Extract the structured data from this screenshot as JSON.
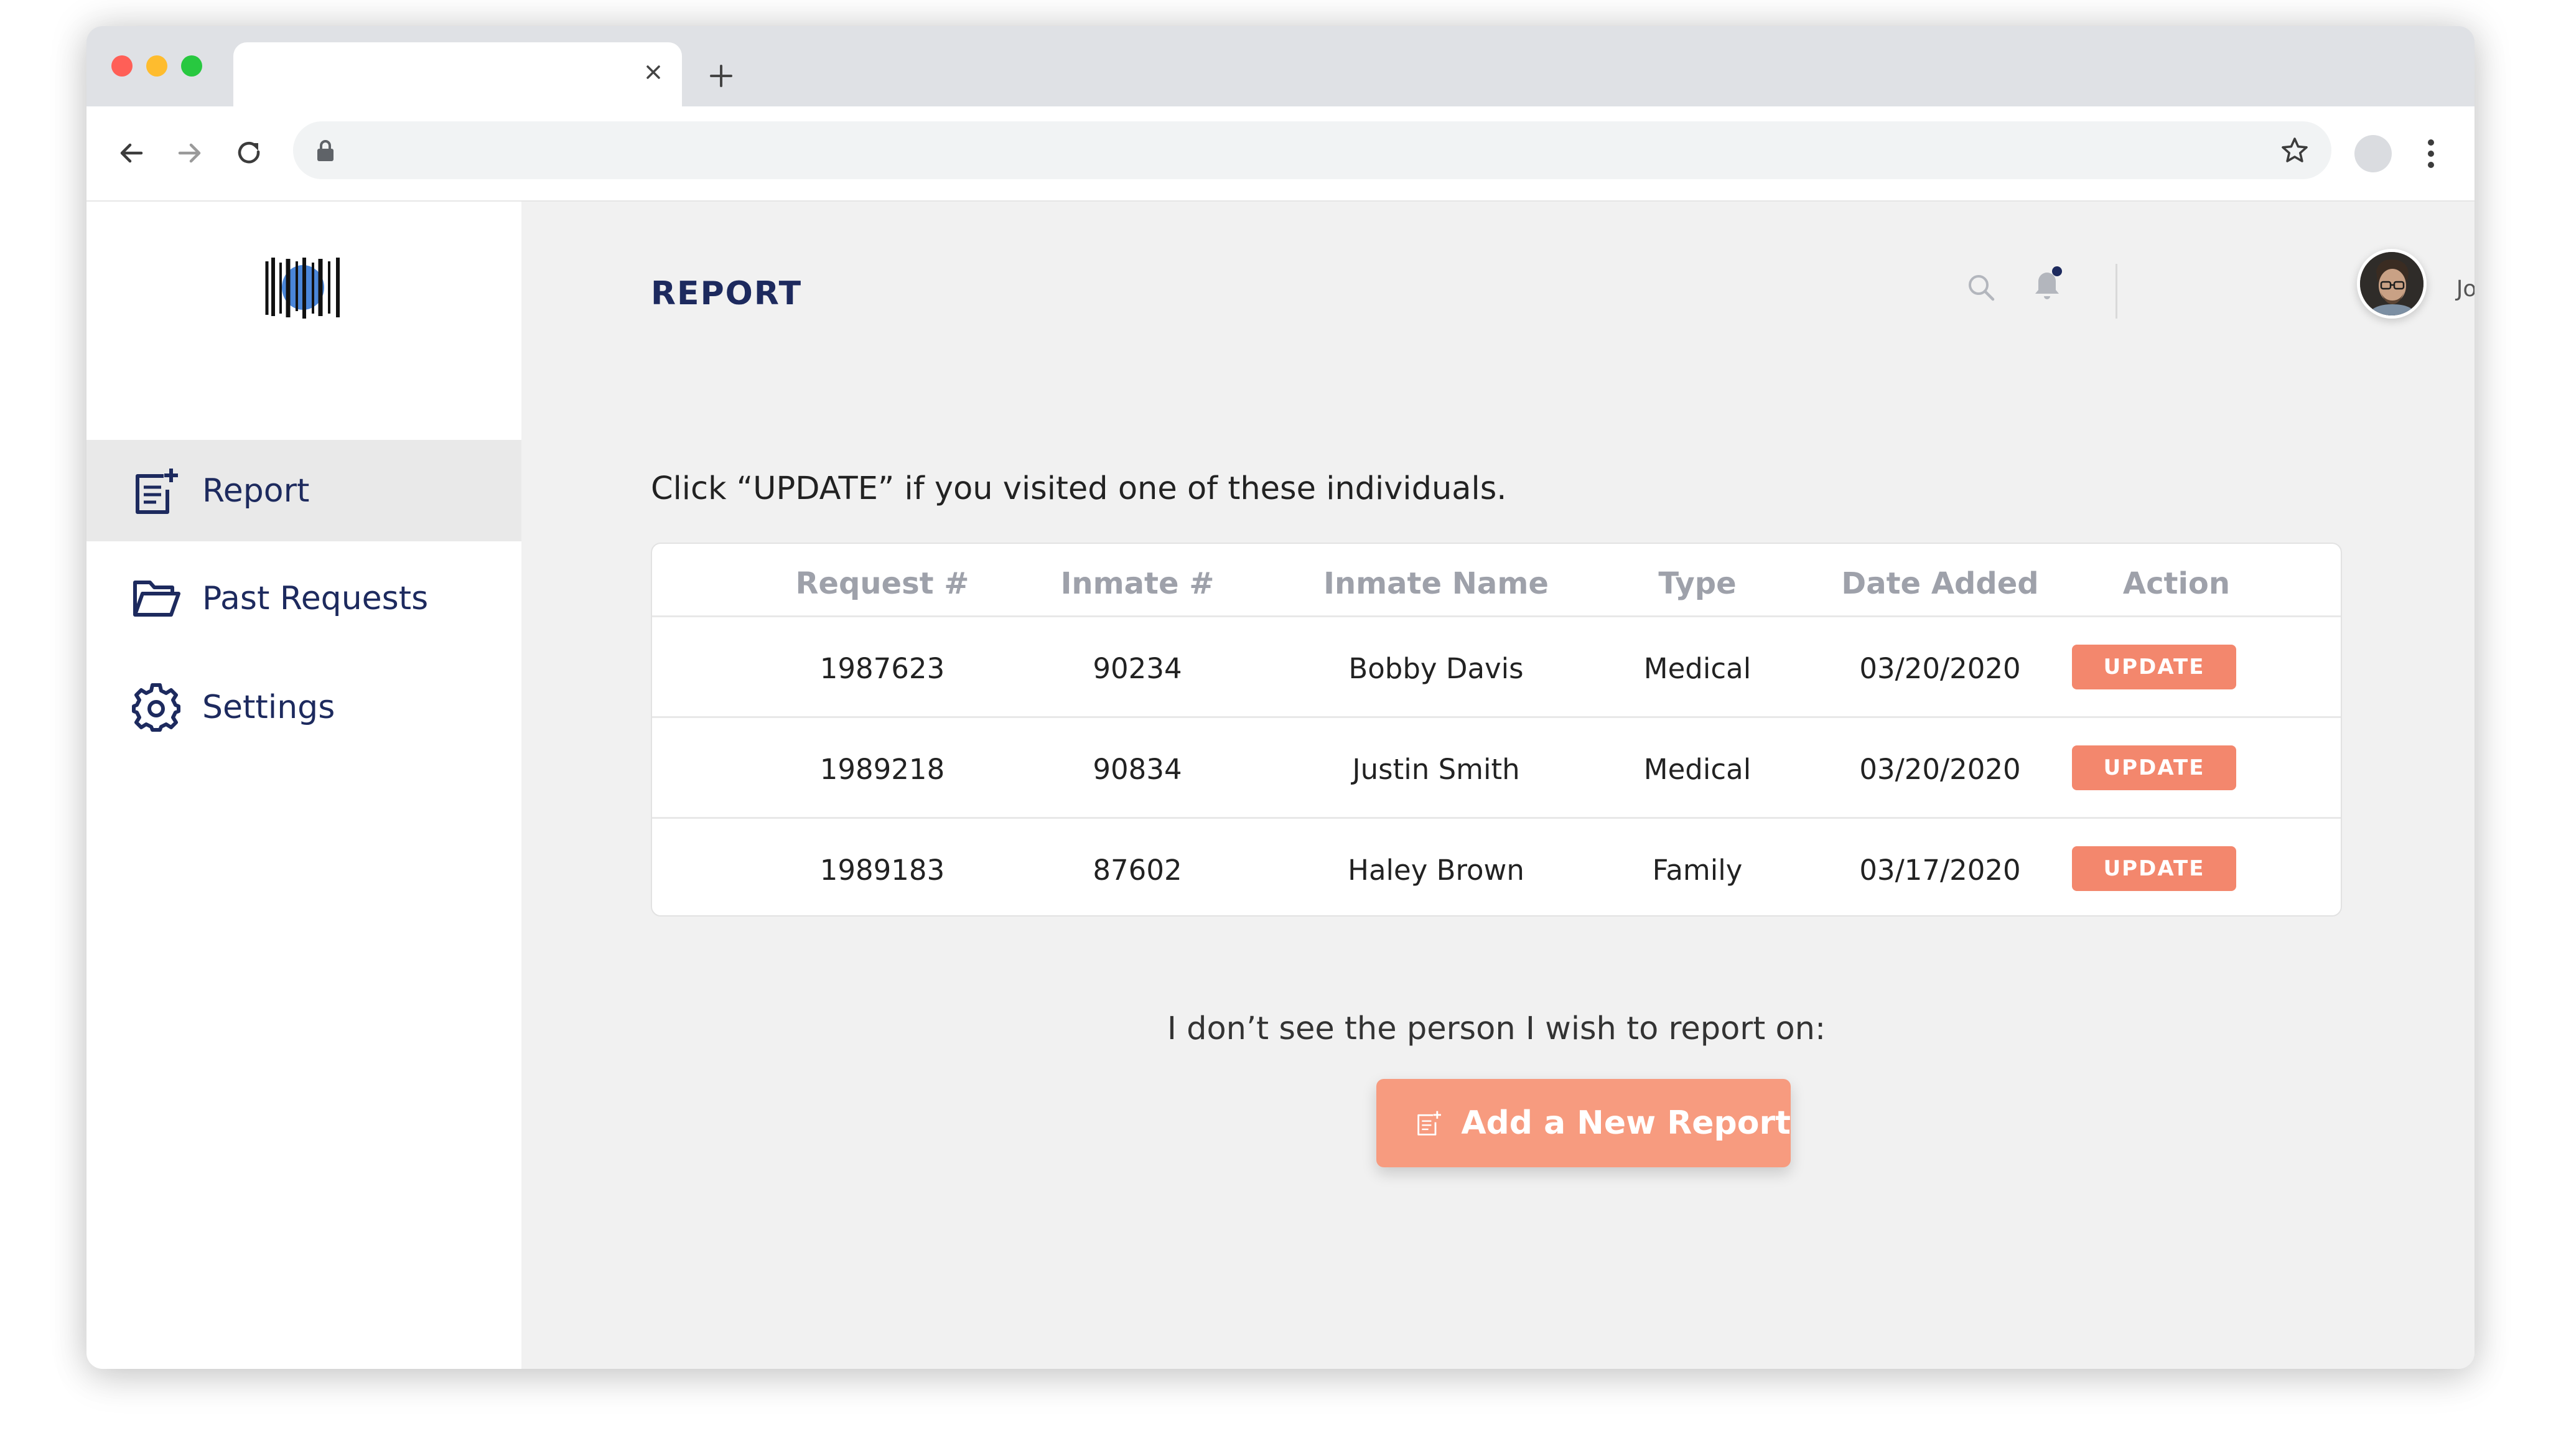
{
  "browser": {
    "tab_title": "",
    "tab_close_icon": "close-icon",
    "new_tab_icon": "plus-icon",
    "url": "",
    "nav_icons": [
      "arrow-left-icon",
      "arrow-right-icon",
      "reload-icon"
    ]
  },
  "sidebar": {
    "logo_icon": "barcode-logo",
    "items": [
      {
        "label": "Report",
        "icon": "report-add-icon",
        "active": true
      },
      {
        "label": "Past Requests",
        "icon": "folder-open-icon",
        "active": false
      },
      {
        "label": "Settings",
        "icon": "gear-icon",
        "active": false
      }
    ]
  },
  "header": {
    "title": "REPORT",
    "user_name": "Jones Ferdinand"
  },
  "main": {
    "instruction": "Click “UPDATE” if you visited one of these individuals.",
    "table": {
      "columns": [
        "Request #",
        "Inmate #",
        "Inmate Name",
        "Type",
        "Date Added",
        "Action"
      ],
      "rows": [
        {
          "request": "1987623",
          "inmate": "90234",
          "name": "Bobby Davis",
          "type": "Medical",
          "date": "03/20/2020",
          "action": "UPDATE"
        },
        {
          "request": "1989218",
          "inmate": "90834",
          "name": "Justin Smith",
          "type": "Medical",
          "date": "03/20/2020",
          "action": "UPDATE"
        },
        {
          "request": "1989183",
          "inmate": "87602",
          "name": "Haley Brown",
          "type": "Family",
          "date": "03/17/2020",
          "action": "UPDATE"
        }
      ]
    },
    "no_person_text": "I don’t see the person I wish to report on:",
    "add_report_label": "Add a New Report"
  },
  "colors": {
    "navy": "#1d2a5e",
    "accent_orange": "#f3876d",
    "button_orange": "#f79b7f",
    "notification_dot": "#1d2a5e"
  }
}
